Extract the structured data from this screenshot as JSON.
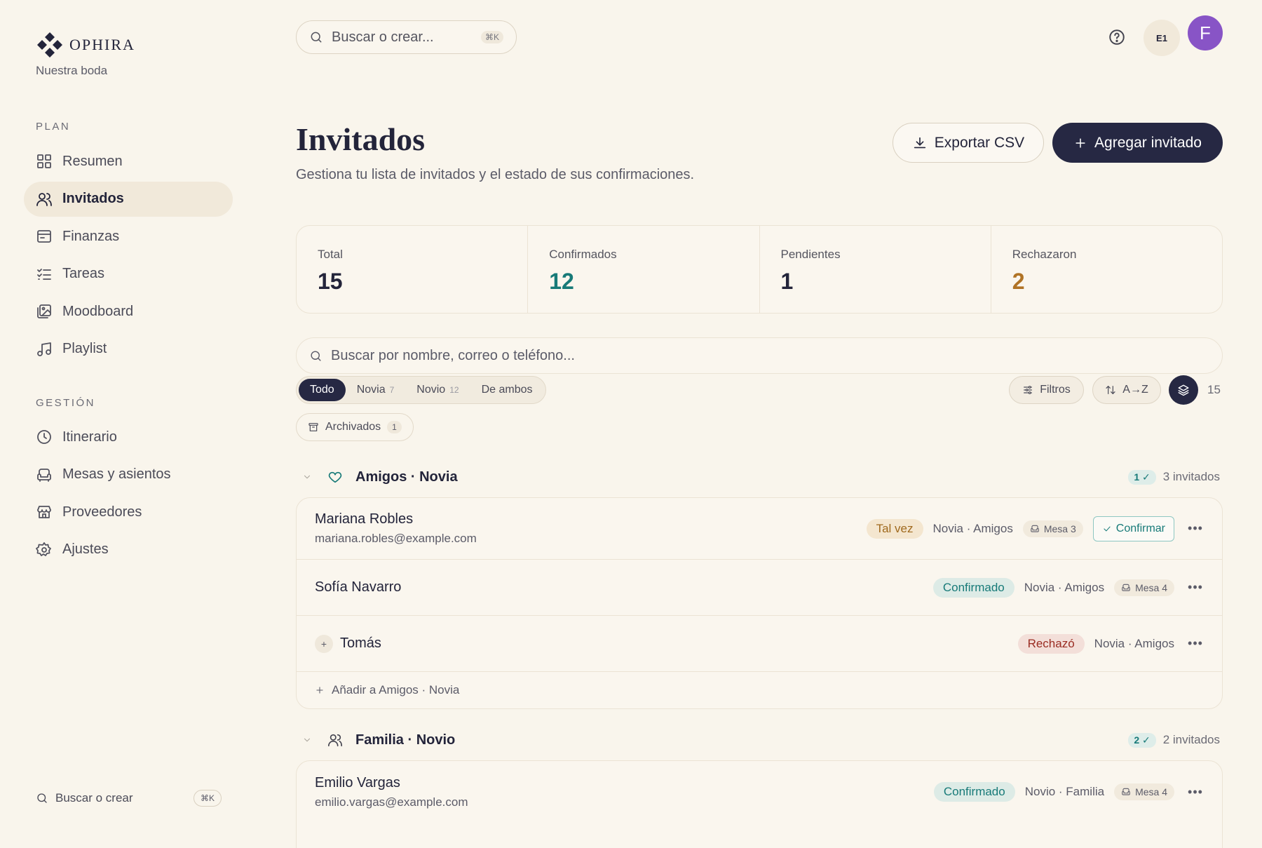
{
  "brand": {
    "name": "OPHIRA",
    "workspace": "Nuestra boda"
  },
  "sidebar": {
    "plan_label": "PLAN",
    "plan_items": [
      {
        "label": "Resumen",
        "icon": "grid-icon"
      },
      {
        "label": "Invitados",
        "icon": "users-icon",
        "active": true
      },
      {
        "label": "Finanzas",
        "icon": "wallet-icon"
      },
      {
        "label": "Tareas",
        "icon": "checklist-icon"
      },
      {
        "label": "Moodboard",
        "icon": "images-icon"
      },
      {
        "label": "Playlist",
        "icon": "music-icon"
      }
    ],
    "gestion_label": "GESTIÓN",
    "gestion_items": [
      {
        "label": "Itinerario",
        "icon": "clock-icon"
      },
      {
        "label": "Mesas y asientos",
        "icon": "armchair-icon"
      },
      {
        "label": "Proveedores",
        "icon": "store-icon"
      },
      {
        "label": "Ajustes",
        "icon": "gear-icon"
      }
    ],
    "search_label": "Buscar o crear",
    "search_kbd": "⌘K"
  },
  "topbar": {
    "search_placeholder": "Buscar o crear...",
    "search_kbd": "⌘K",
    "env_badge": "E1",
    "avatar_initial": "F"
  },
  "header": {
    "title": "Invitados",
    "subtitle": "Gestiona tu lista de invitados y el estado de sus confirmaciones.",
    "export_label": "Exportar CSV",
    "add_label": "Agregar invitado"
  },
  "stats": [
    {
      "label": "Total",
      "value": "15",
      "color": "#23243a"
    },
    {
      "label": "Confirmados",
      "value": "12",
      "color": "#177a78"
    },
    {
      "label": "Pendientes",
      "value": "1",
      "color": "#23243a"
    },
    {
      "label": "Rechazaron",
      "value": "2",
      "color": "#b07325"
    }
  ],
  "filters": {
    "search_placeholder": "Buscar por nombre, correo o teléfono...",
    "segments": [
      {
        "label": "Todo",
        "count": ""
      },
      {
        "label": "Novia",
        "count": "7"
      },
      {
        "label": "Novio",
        "count": "12"
      },
      {
        "label": "De ambos",
        "count": ""
      }
    ],
    "filters_label": "Filtros",
    "sort_label": "A→Z",
    "total_count": "15",
    "archived_label": "Archivados",
    "archived_count": "1"
  },
  "groups": [
    {
      "name": "Amigos · Novia",
      "icon": "heart-icon",
      "confirmed": "1 ✓",
      "count_label": "3 invitados",
      "guests": [
        {
          "name": "Mariana Robles",
          "email": "mariana.robles@example.com",
          "status": "Tal vez",
          "status_type": "maybe",
          "meta": "Novia · Amigos",
          "table": "Mesa 3",
          "confirm": "Confirmar"
        },
        {
          "name": "Sofía Navarro",
          "email": "",
          "status": "Confirmado",
          "status_type": "conf",
          "meta": "Novia · Amigos",
          "table": "Mesa 4"
        },
        {
          "name": "Tomás",
          "email": "",
          "status": "Rechazó",
          "status_type": "rej",
          "meta": "Novia · Amigos",
          "table": "",
          "plus_one": "+"
        }
      ],
      "add_label": "Añadir a Amigos · Novia"
    },
    {
      "name": "Familia · Novio",
      "icon": "users-icon",
      "confirmed": "2 ✓",
      "count_label": "2 invitados",
      "guests": [
        {
          "name": "Emilio Vargas",
          "email": "emilio.vargas@example.com",
          "status": "Confirmado",
          "status_type": "conf",
          "meta": "Novio · Familia",
          "table": "Mesa 4"
        }
      ]
    }
  ],
  "dots_label": "•••"
}
